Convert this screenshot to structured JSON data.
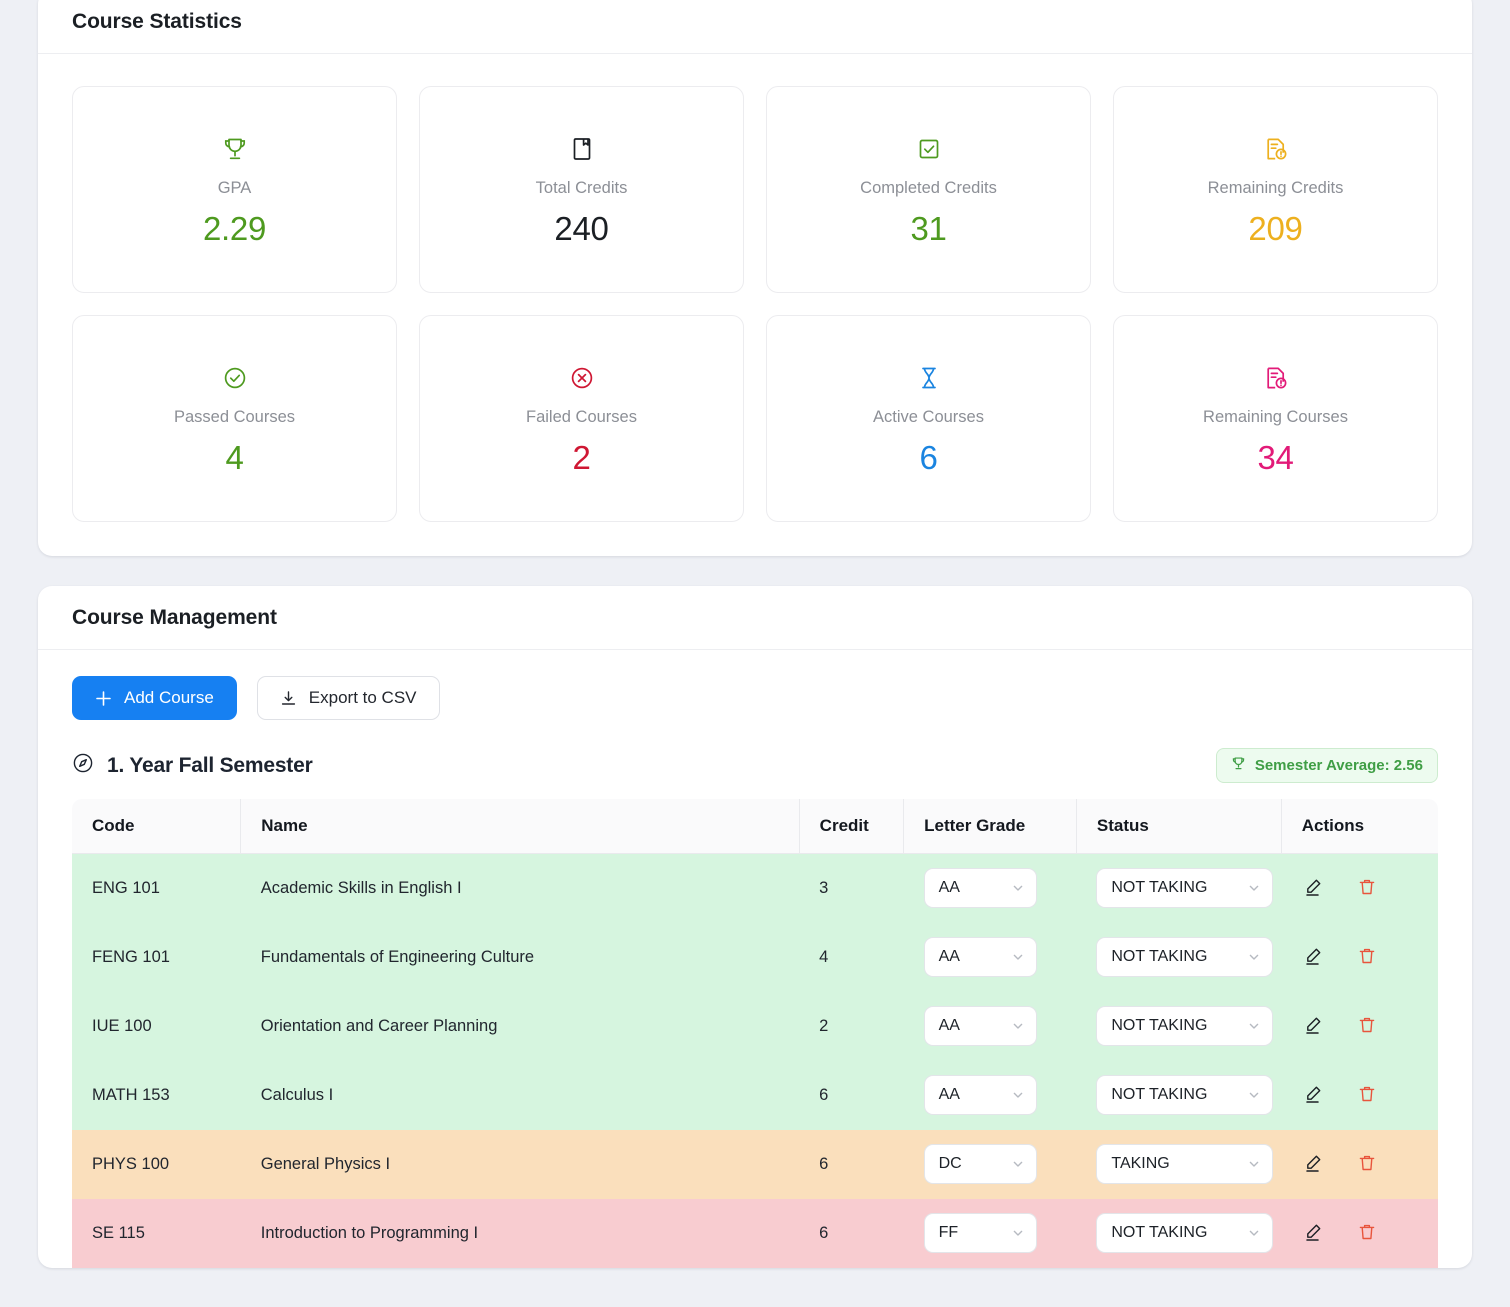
{
  "statistics": {
    "title": "Course Statistics",
    "cards": [
      {
        "icon": "trophy-icon",
        "label": "GPA",
        "value": "2.29",
        "color": "#4e9a1f"
      },
      {
        "icon": "book-icon",
        "label": "Total Credits",
        "value": "240",
        "color": "#1b1f24"
      },
      {
        "icon": "check-square-icon",
        "label": "Completed Credits",
        "value": "31",
        "color": "#4e9a1f"
      },
      {
        "icon": "file-exclamation-icon",
        "label": "Remaining Credits",
        "value": "209",
        "color": "#edb01f"
      },
      {
        "icon": "check-circle-icon",
        "label": "Passed Courses",
        "value": "4",
        "color": "#4e9a1f"
      },
      {
        "icon": "close-circle-icon",
        "label": "Failed Courses",
        "value": "2",
        "color": "#cf1733"
      },
      {
        "icon": "hourglass-icon",
        "label": "Active Courses",
        "value": "6",
        "color": "#1a84e0"
      },
      {
        "icon": "file-exclamation-icon",
        "label": "Remaining Courses",
        "value": "34",
        "color": "#e21a78"
      }
    ]
  },
  "management": {
    "title": "Course Management",
    "add_course_label": "Add Course",
    "export_label": "Export to CSV",
    "semester": {
      "title": "1. Year Fall Semester",
      "badge": "Semester Average: 2.56"
    },
    "table": {
      "headers": [
        "Code",
        "Name",
        "Credit",
        "Letter Grade",
        "Status",
        "Actions"
      ],
      "rows": [
        {
          "code": "ENG 101",
          "name": "Academic Skills in English I",
          "credit": "3",
          "grade": "AA",
          "status": "NOT TAKING",
          "state": "row-pass"
        },
        {
          "code": "FENG 101",
          "name": "Fundamentals of Engineering Culture",
          "credit": "4",
          "grade": "AA",
          "status": "NOT TAKING",
          "state": "row-pass"
        },
        {
          "code": "IUE 100",
          "name": "Orientation and Career Planning",
          "credit": "2",
          "grade": "AA",
          "status": "NOT TAKING",
          "state": "row-pass"
        },
        {
          "code": "MATH 153",
          "name": "Calculus I",
          "credit": "6",
          "grade": "AA",
          "status": "NOT TAKING",
          "state": "row-pass"
        },
        {
          "code": "PHYS 100",
          "name": "General Physics I",
          "credit": "6",
          "grade": "DC",
          "status": "TAKING",
          "state": "row-active"
        },
        {
          "code": "SE 115",
          "name": "Introduction to Programming I",
          "credit": "6",
          "grade": "FF",
          "status": "NOT TAKING",
          "state": "row-fail"
        }
      ],
      "edit_icon": "edit-pencil-icon",
      "delete_icon": "trash-icon"
    }
  },
  "colors": {
    "primary": "#1680f2",
    "page_background": "#eef0f5",
    "pass_row": "#d6f5df",
    "active_row": "#fadfbc",
    "fail_row": "#f8ccd0"
  }
}
